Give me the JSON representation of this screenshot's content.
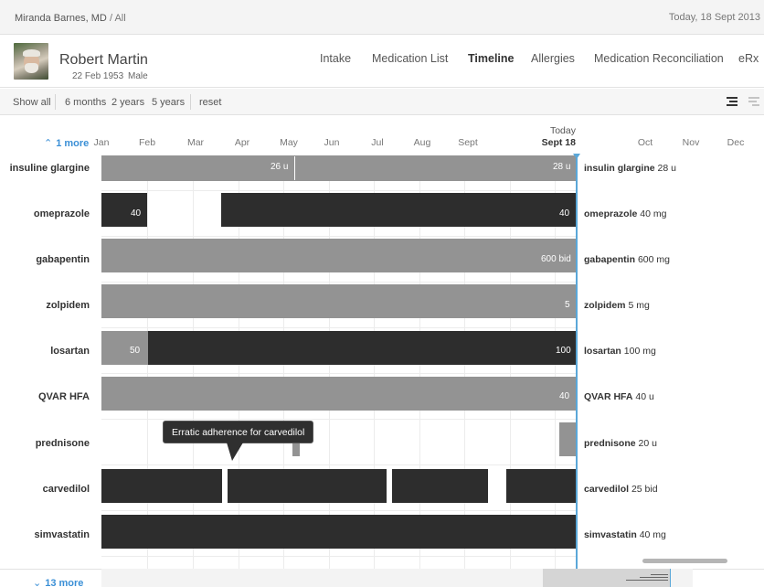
{
  "breadcrumb": {
    "doctor": "Miranda Barnes, MD",
    "separator": "/",
    "scope": "All"
  },
  "today_top": "Today, 18 Sept 2013",
  "patient": {
    "name": "Robert Martin",
    "dob": "22 Feb 1953",
    "sex": "Male"
  },
  "tabs": [
    {
      "label": "Intake",
      "active": false
    },
    {
      "label": "Medication List",
      "active": false
    },
    {
      "label": "Timeline",
      "active": true
    },
    {
      "label": "Allergies",
      "active": false
    },
    {
      "label": "Medication Reconciliation",
      "active": false
    },
    {
      "label": "eRx",
      "active": false
    }
  ],
  "toolbar": {
    "show_all": "Show all",
    "ranges": [
      "6 months",
      "2 years",
      "5 years"
    ],
    "reset": "reset"
  },
  "timeline": {
    "more_above": "1 more",
    "more_above_icon": "chevron-up-icon",
    "more_below": "13 more",
    "more_below_icon": "chevron-down-icon",
    "months_before": [
      "Jan",
      "Feb",
      "Mar",
      "Apr",
      "May",
      "Jun",
      "Jul",
      "Aug",
      "Sept"
    ],
    "months_after": [
      "Oct",
      "Nov",
      "Dec"
    ],
    "today_label": "Today",
    "today_date": "Sept 18",
    "today_color": "#5aa7d8"
  },
  "colors": {
    "active_bar": "#2d2d2d",
    "inactive_bar": "#939393",
    "link": "#3a8fd6"
  },
  "medications": [
    {
      "name": "insuline glargine",
      "current_name": "insulin glargine",
      "current_dose": "28 u",
      "labels": [
        "26 u",
        "28 u"
      ]
    },
    {
      "name": "omeprazole",
      "current_name": "omeprazole",
      "current_dose": "40 mg",
      "labels": [
        "40",
        "40"
      ]
    },
    {
      "name": "gabapentin",
      "current_name": "gabapentin",
      "current_dose": "600 mg",
      "labels": [
        "600 bid"
      ]
    },
    {
      "name": "zolpidem",
      "current_name": "zolpidem",
      "current_dose": "5 mg",
      "labels": [
        "5"
      ]
    },
    {
      "name": "losartan",
      "current_name": "losartan",
      "current_dose": "100 mg",
      "labels": [
        "50",
        "100"
      ]
    },
    {
      "name": "QVAR  HFA",
      "current_name": "QVAR HFA",
      "current_dose": "40 u",
      "labels": [
        "40"
      ]
    },
    {
      "name": "prednisone",
      "current_name": "prednisone",
      "current_dose": "20 u",
      "labels": []
    },
    {
      "name": "carvedilol",
      "current_name": "carvedilol",
      "current_dose": "25 bid",
      "labels": []
    },
    {
      "name": "simvastatin",
      "current_name": "simvastatin",
      "current_dose": "40 mg",
      "labels": []
    }
  ],
  "tooltip": "Erratic adherence for carvedilol"
}
